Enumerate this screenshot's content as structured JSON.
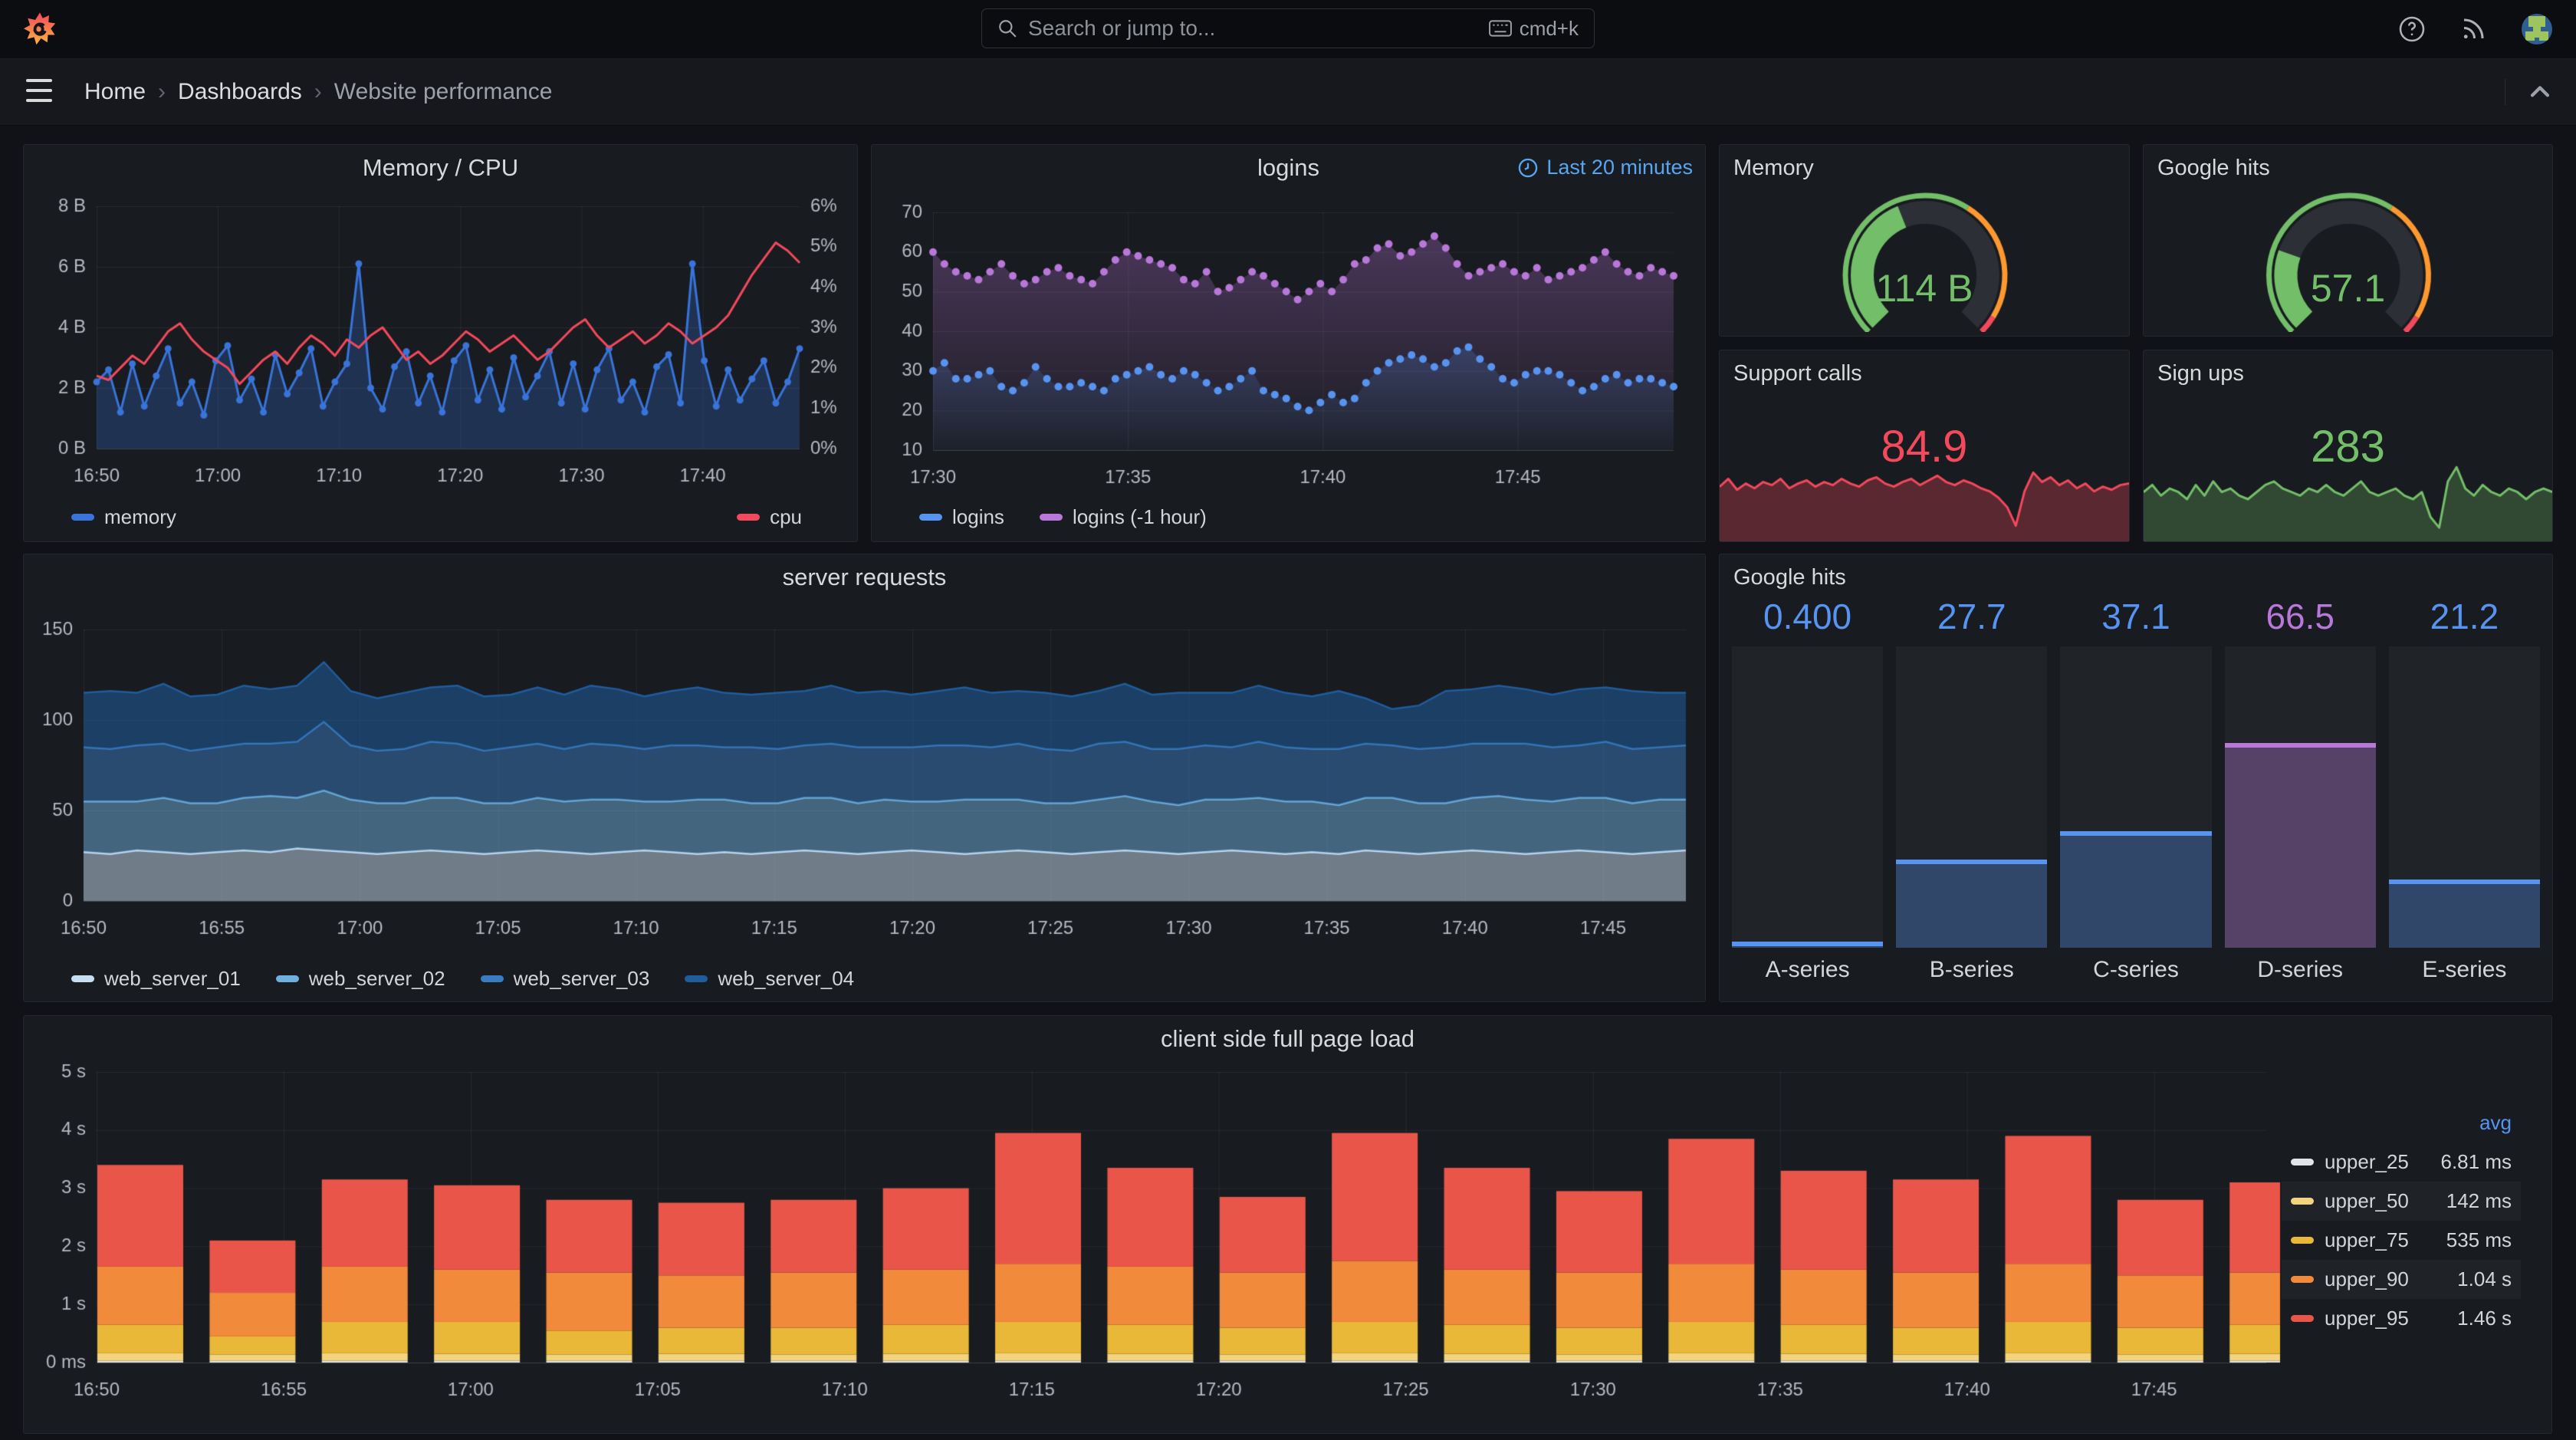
{
  "nav": {
    "search_placeholder": "Search or jump to...",
    "shortcut": "cmd+k"
  },
  "breadcrumb": {
    "items": [
      "Home",
      "Dashboards",
      "Website performance"
    ]
  },
  "panels": {
    "memory_cpu": {
      "title": "Memory / CPU"
    },
    "logins": {
      "title": "logins",
      "badge": "Last 20 minutes"
    },
    "memory_gauge": {
      "title": "Memory",
      "value": "114 B"
    },
    "google_gauge": {
      "title": "Google hits",
      "value": "57.1"
    },
    "support_calls": {
      "title": "Support calls",
      "value": "84.9"
    },
    "sign_ups": {
      "title": "Sign ups",
      "value": "283"
    },
    "server_requests": {
      "title": "server requests"
    },
    "google_bars": {
      "title": "Google hits"
    },
    "client_load": {
      "title": "client side full page load",
      "legend_header": "avg"
    }
  },
  "colors": {
    "green": "#73bf69",
    "red": "#f2495c",
    "orange": "#ff9830",
    "blue": "#5794f2",
    "purple": "#b877d9"
  },
  "chart_data": [
    {
      "id": "memory_cpu",
      "type": "line",
      "x_labels": [
        "16:50",
        "17:00",
        "17:10",
        "17:20",
        "17:30",
        "17:40"
      ],
      "x_fracs": [
        0,
        0.1724,
        0.3448,
        0.5172,
        0.6897,
        0.8621
      ],
      "y_left": [
        "0 B",
        "2 B",
        "4 B",
        "6 B",
        "8 B"
      ],
      "ylim": [
        0,
        8
      ],
      "y_right": [
        "0%",
        "1%",
        "2%",
        "3%",
        "4%",
        "5%",
        "6%"
      ],
      "ylim_right": [
        0,
        6
      ],
      "series": [
        {
          "name": "memory",
          "axis": "left",
          "color": "#3874d9",
          "fill": "rgba(56,116,217,0.27)",
          "values": [
            2.2,
            2.6,
            1.2,
            2.8,
            1.4,
            2.4,
            3.3,
            1.5,
            2.2,
            1.1,
            2.9,
            3.4,
            1.6,
            2.3,
            1.2,
            3.1,
            1.8,
            2.5,
            3.3,
            1.4,
            2.2,
            2.8,
            6.1,
            2.0,
            1.3,
            2.7,
            3.2,
            1.5,
            2.4,
            1.2,
            2.9,
            3.4,
            1.6,
            2.6,
            1.3,
            3.0,
            1.7,
            2.4,
            3.2,
            1.5,
            2.8,
            1.3,
            2.6,
            3.3,
            1.6,
            2.2,
            1.2,
            2.7,
            3.1,
            1.5,
            6.1,
            2.9,
            1.4,
            2.6,
            1.6,
            2.3,
            2.9,
            1.5,
            2.2,
            3.3
          ]
        },
        {
          "name": "cpu",
          "axis": "right",
          "color": "#f2495c",
          "values": [
            1.8,
            1.7,
            2.0,
            2.3,
            2.1,
            2.5,
            2.9,
            3.1,
            2.7,
            2.4,
            2.2,
            2.0,
            1.6,
            1.9,
            2.2,
            2.4,
            2.1,
            2.5,
            2.8,
            2.6,
            2.3,
            2.7,
            2.5,
            2.8,
            3.0,
            2.6,
            2.2,
            2.4,
            2.1,
            2.3,
            2.6,
            2.9,
            2.7,
            2.4,
            2.6,
            2.8,
            2.5,
            2.2,
            2.4,
            2.7,
            3.0,
            3.2,
            2.8,
            2.5,
            2.7,
            2.9,
            2.6,
            2.8,
            3.1,
            2.9,
            2.6,
            2.8,
            3.0,
            3.3,
            3.8,
            4.3,
            4.7,
            5.1,
            4.9,
            4.6
          ]
        }
      ]
    },
    {
      "id": "logins",
      "type": "scatter",
      "x_labels": [
        "17:30",
        "17:35",
        "17:40",
        "17:45"
      ],
      "x_fracs": [
        0,
        0.2632,
        0.5263,
        0.7895
      ],
      "y_ticks": [
        "10",
        "20",
        "30",
        "40",
        "50",
        "60",
        "70"
      ],
      "ylim": [
        10,
        70
      ],
      "series": [
        {
          "name": "logins (-1 hour)",
          "color": "#b877d9",
          "values": [
            60,
            57,
            55,
            54,
            53,
            55,
            57,
            54,
            52,
            53,
            55,
            56,
            54,
            53,
            52,
            55,
            58,
            60,
            59,
            58,
            57,
            56,
            53,
            52,
            55,
            50,
            51,
            53,
            55,
            54,
            52,
            50,
            48,
            50,
            52,
            50,
            53,
            57,
            58,
            61,
            62,
            59,
            60,
            62,
            64,
            61,
            57,
            54,
            55,
            56,
            57,
            55,
            54,
            56,
            53,
            54,
            55,
            56,
            58,
            60,
            57,
            55,
            54,
            56,
            55,
            54
          ]
        },
        {
          "name": "logins",
          "color": "#5794f2",
          "values": [
            30,
            32,
            28,
            28,
            29,
            30,
            26,
            25,
            27,
            31,
            28,
            26,
            26,
            27,
            26,
            25,
            28,
            29,
            30,
            31,
            29,
            28,
            30,
            29,
            27,
            25,
            26,
            28,
            30,
            25,
            24,
            23,
            21,
            20,
            22,
            24,
            22,
            23,
            27,
            30,
            32,
            33,
            34,
            33,
            31,
            32,
            35,
            36,
            33,
            31,
            28,
            27,
            29,
            30,
            30,
            29,
            27,
            25,
            26,
            28,
            29,
            27,
            28,
            28,
            27,
            26
          ]
        }
      ]
    },
    {
      "id": "server_requests",
      "type": "area-stacked",
      "x_labels": [
        "16:50",
        "16:55",
        "17:00",
        "17:05",
        "17:10",
        "17:15",
        "17:20",
        "17:25",
        "17:30",
        "17:35",
        "17:40",
        "17:45"
      ],
      "x_fracs": [
        0,
        0.0862,
        0.1724,
        0.2586,
        0.3448,
        0.431,
        0.5172,
        0.6034,
        0.6897,
        0.7759,
        0.8621,
        0.9483
      ],
      "y_ticks": [
        "0",
        "50",
        "100",
        "150"
      ],
      "ylim": [
        0,
        150
      ],
      "series": [
        {
          "name": "web_server_01",
          "color": "#c7def1",
          "fill": "rgba(199,222,241,0.50)",
          "values": [
            27,
            26,
            28,
            27,
            26,
            27,
            28,
            27,
            29,
            28,
            27,
            26,
            27,
            28,
            27,
            26,
            27,
            28,
            27,
            26,
            27,
            28,
            27,
            26,
            27,
            26,
            27,
            28,
            27,
            26,
            27,
            28,
            27,
            26,
            27,
            28,
            27,
            26,
            27,
            28,
            27,
            26,
            27,
            28,
            27,
            26,
            27,
            26,
            28,
            27,
            26,
            27,
            28,
            27,
            26,
            27,
            28,
            27,
            26,
            27,
            28
          ]
        },
        {
          "name": "web_server_02",
          "color": "#6fb0dd",
          "fill": "rgba(111,176,221,0.50)",
          "values": [
            28,
            29,
            27,
            30,
            28,
            27,
            29,
            31,
            28,
            33,
            29,
            28,
            27,
            29,
            30,
            28,
            27,
            29,
            28,
            30,
            29,
            27,
            28,
            30,
            29,
            28,
            27,
            29,
            30,
            28,
            29,
            27,
            28,
            30,
            29,
            28,
            27,
            28,
            29,
            30,
            28,
            27,
            29,
            28,
            30,
            29,
            28,
            27,
            29,
            30,
            28,
            27,
            29,
            31,
            30,
            28,
            29,
            30,
            28,
            29,
            28
          ]
        },
        {
          "name": "web_server_03",
          "color": "#3a7cc1",
          "fill": "rgba(58,124,193,0.50)",
          "values": [
            30,
            29,
            31,
            30,
            29,
            31,
            30,
            29,
            31,
            38,
            30,
            29,
            30,
            31,
            30,
            29,
            31,
            30,
            29,
            31,
            30,
            29,
            31,
            30,
            29,
            31,
            30,
            29,
            30,
            31,
            29,
            30,
            31,
            30,
            29,
            31,
            30,
            29,
            31,
            30,
            29,
            31,
            30,
            29,
            31,
            30,
            29,
            31,
            30,
            29,
            30,
            31,
            30,
            29,
            31,
            30,
            29,
            31,
            30,
            29,
            30
          ]
        },
        {
          "name": "web_server_04",
          "color": "#1f5d9e",
          "fill": "rgba(31,93,158,0.55)",
          "values": [
            30,
            32,
            29,
            33,
            30,
            29,
            32,
            30,
            31,
            33,
            30,
            29,
            31,
            30,
            32,
            30,
            29,
            31,
            30,
            32,
            31,
            29,
            30,
            32,
            30,
            29,
            31,
            30,
            32,
            30,
            31,
            29,
            30,
            32,
            30,
            29,
            31,
            30,
            29,
            32,
            30,
            31,
            29,
            30,
            31,
            30,
            29,
            32,
            25,
            20,
            24,
            31,
            30,
            32,
            30,
            29,
            31,
            30,
            32,
            30,
            29
          ]
        }
      ]
    },
    {
      "id": "google_bars",
      "type": "bar",
      "max": 100,
      "categories": [
        "A-series",
        "B-series",
        "C-series",
        "D-series",
        "E-series"
      ],
      "values": [
        0.4,
        27.7,
        37.1,
        66.5,
        21.2
      ],
      "displays": [
        "0.400",
        "27.7",
        "37.1",
        "66.5",
        "21.2"
      ],
      "value_colors": [
        "#5794f2",
        "#5794f2",
        "#5794f2",
        "#b877d9",
        "#5794f2"
      ],
      "fill_colors": [
        "rgba(87,148,242,0.32)",
        "rgba(87,148,242,0.32)",
        "rgba(87,148,242,0.32)",
        "rgba(184,119,217,0.36)",
        "rgba(87,148,242,0.32)"
      ],
      "edge_colors": [
        "#5794f2",
        "#5794f2",
        "#5794f2",
        "#b877d9",
        "#5794f2"
      ]
    },
    {
      "id": "client_load",
      "type": "bar-stacked",
      "x_labels": [
        "16:50",
        "16:55",
        "17:00",
        "17:05",
        "17:10",
        "17:15",
        "17:20",
        "17:25",
        "17:30",
        "17:35",
        "17:40",
        "17:45"
      ],
      "x_fracs": [
        0,
        0.0862,
        0.1724,
        0.2586,
        0.3448,
        0.431,
        0.5172,
        0.6034,
        0.6897,
        0.7759,
        0.8621,
        0.9483
      ],
      "y_ticks": [
        "0 ms",
        "1 s",
        "2 s",
        "3 s",
        "4 s",
        "5 s"
      ],
      "ylim": [
        0,
        5
      ],
      "span_minutes": 58,
      "bar_minutes": [
        0,
        3,
        6,
        9,
        12,
        15,
        18,
        21,
        24,
        27,
        30,
        33,
        36,
        39,
        42,
        45,
        48,
        51,
        54,
        57
      ],
      "series_names": [
        "upper_25",
        "upper_50",
        "upper_75",
        "upper_90",
        "upper_95"
      ],
      "segment_colors": [
        "#e3e4e8",
        "#f3d37e",
        "#eab839",
        "#f28a3c",
        "#e95649"
      ],
      "avg": [
        "6.81 ms",
        "142 ms",
        "535 ms",
        "1.04 s",
        "1.46 s"
      ],
      "bars": [
        [
          0.03,
          0.16,
          0.65,
          1.65,
          3.4
        ],
        [
          0.03,
          0.14,
          0.45,
          1.2,
          2.1
        ],
        [
          0.03,
          0.16,
          0.7,
          1.65,
          3.15
        ],
        [
          0.03,
          0.15,
          0.7,
          1.6,
          3.05
        ],
        [
          0.03,
          0.14,
          0.55,
          1.55,
          2.8
        ],
        [
          0.03,
          0.15,
          0.6,
          1.5,
          2.75
        ],
        [
          0.03,
          0.14,
          0.6,
          1.55,
          2.8
        ],
        [
          0.03,
          0.15,
          0.65,
          1.6,
          3.0
        ],
        [
          0.03,
          0.16,
          0.7,
          1.7,
          3.95
        ],
        [
          0.03,
          0.15,
          0.65,
          1.65,
          3.35
        ],
        [
          0.03,
          0.14,
          0.6,
          1.55,
          2.85
        ],
        [
          0.03,
          0.16,
          0.7,
          1.75,
          3.95
        ],
        [
          0.03,
          0.15,
          0.65,
          1.6,
          3.35
        ],
        [
          0.03,
          0.14,
          0.6,
          1.55,
          2.95
        ],
        [
          0.03,
          0.16,
          0.7,
          1.7,
          3.85
        ],
        [
          0.03,
          0.15,
          0.65,
          1.6,
          3.3
        ],
        [
          0.03,
          0.14,
          0.6,
          1.55,
          3.15
        ],
        [
          0.03,
          0.16,
          0.7,
          1.7,
          3.9
        ],
        [
          0.03,
          0.14,
          0.6,
          1.5,
          2.8
        ],
        [
          0.03,
          0.15,
          0.65,
          1.55,
          3.1
        ]
      ]
    },
    {
      "id": "support_spark",
      "type": "sparkline",
      "color": "#f2495c",
      "fill": "rgba(242,73,92,0.30)",
      "ylim": [
        50,
        100
      ],
      "values": [
        83,
        88,
        81,
        85,
        82,
        86,
        84,
        88,
        82,
        85,
        87,
        83,
        86,
        84,
        88,
        85,
        83,
        87,
        89,
        85,
        83,
        86,
        88,
        84,
        87,
        90,
        86,
        84,
        87,
        85,
        82,
        80,
        76,
        70,
        58,
        80,
        92,
        86,
        89,
        84,
        87,
        82,
        85,
        80,
        83,
        81,
        84,
        85
      ]
    },
    {
      "id": "signups_spark",
      "type": "sparkline",
      "color": "#73bf69",
      "fill": "rgba(115,191,105,0.28)",
      "ylim": [
        220,
        330
      ],
      "values": [
        285,
        295,
        280,
        290,
        285,
        275,
        295,
        280,
        300,
        285,
        290,
        280,
        275,
        285,
        295,
        300,
        290,
        285,
        280,
        290,
        285,
        295,
        285,
        280,
        290,
        300,
        285,
        280,
        285,
        290,
        280,
        275,
        285,
        250,
        235,
        300,
        320,
        290,
        280,
        295,
        285,
        280,
        290,
        285,
        275,
        285,
        290,
        285
      ]
    },
    {
      "id": "memory_gauge",
      "type": "gauge",
      "percent": 42,
      "value_text": "114 B",
      "color": "#73bf69",
      "thresholds": [
        {
          "from": 0,
          "to": 62,
          "color": "#73bf69"
        },
        {
          "from": 62,
          "to": 95,
          "color": "#ff9830"
        },
        {
          "from": 95,
          "to": 100,
          "color": "#f2495c"
        }
      ]
    },
    {
      "id": "google_gauge",
      "type": "gauge",
      "percent": 24,
      "value_text": "57.1",
      "color": "#73bf69",
      "thresholds": [
        {
          "from": 0,
          "to": 62,
          "color": "#73bf69"
        },
        {
          "from": 62,
          "to": 95,
          "color": "#ff9830"
        },
        {
          "from": 95,
          "to": 100,
          "color": "#f2495c"
        }
      ]
    }
  ]
}
